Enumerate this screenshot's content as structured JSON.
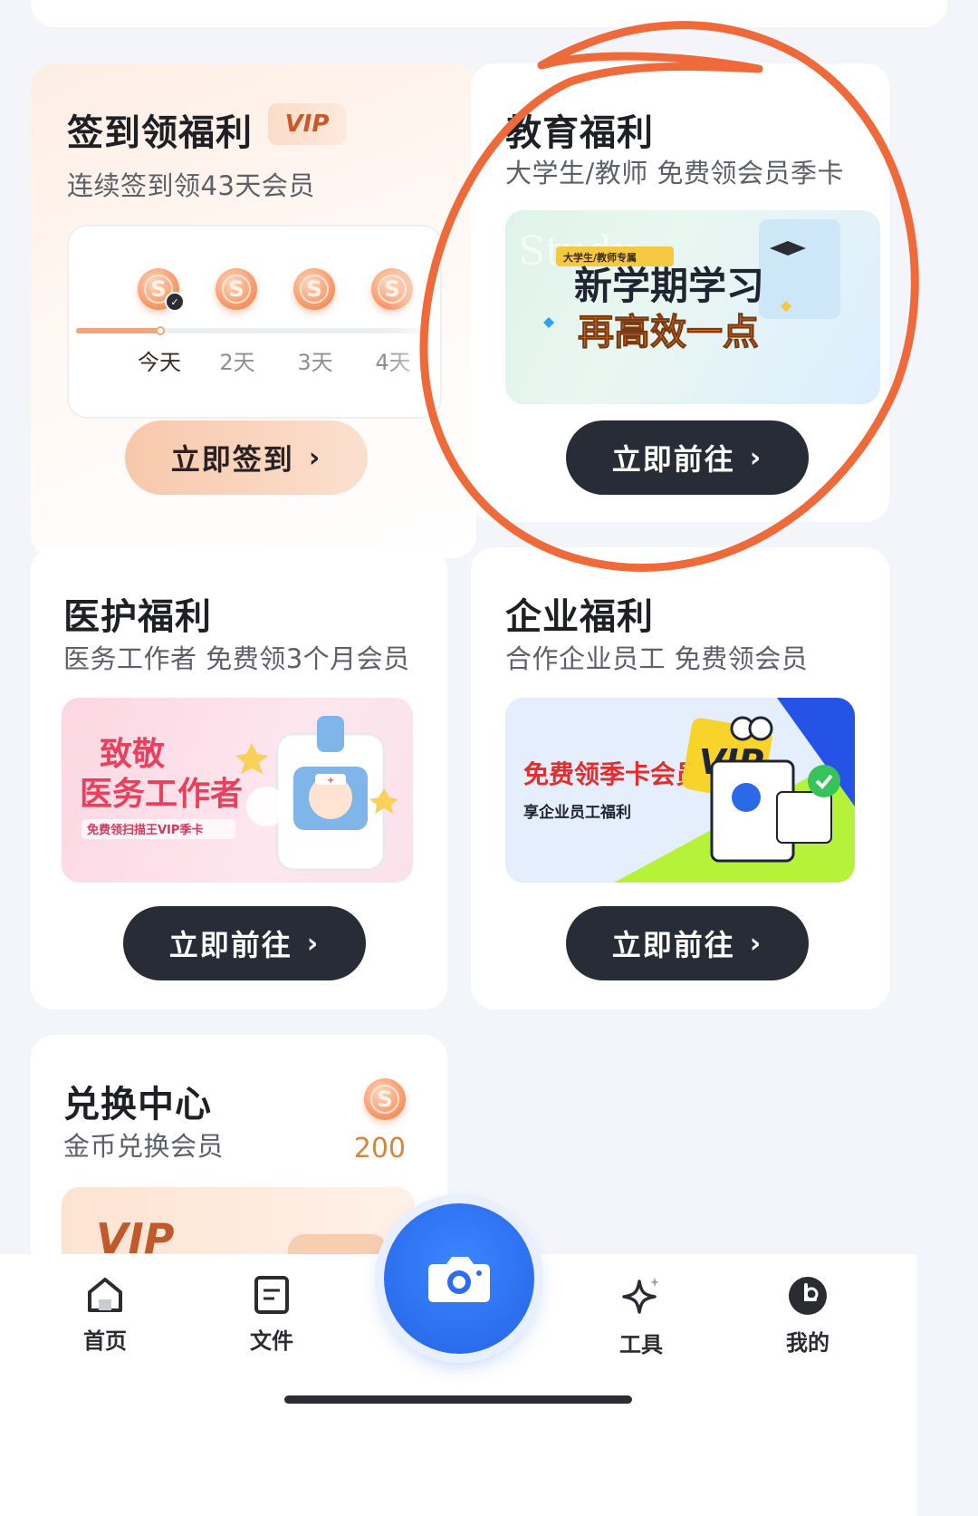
{
  "colors": {
    "accent": "#2563e6",
    "dark_button": "#272c36",
    "annotation": "#ef6a3a",
    "coin": "#f79b6b"
  },
  "checkin": {
    "title": "签到领福利",
    "vip_badge": "VIP",
    "subtitle": "连续签到领43天会员",
    "coin_glyph": "S",
    "days": [
      "今天",
      "2天",
      "3天",
      "4天"
    ],
    "button": "立即签到"
  },
  "education": {
    "title": "教育福利",
    "subtitle": "大学生/教师 免费领会员季卡",
    "banner": {
      "tag": "大学生/教师专属",
      "line1": "新学期学习",
      "line2": "再高效一点",
      "watermark": "Study"
    },
    "button": "立即前往"
  },
  "medical": {
    "title": "医护福利",
    "subtitle": "医务工作者 免费领3个月会员",
    "banner": {
      "line1": "致敬",
      "line2": "医务工作者",
      "caption": "免费领扫描王VIP季卡"
    },
    "button": "立即前往"
  },
  "enterprise": {
    "title": "企业福利",
    "subtitle": "合作企业员工 免费领会员",
    "banner": {
      "line1": "免费领季卡会员",
      "line2": "享企业员工福利",
      "badge": "VIP"
    },
    "button": "立即前往"
  },
  "exchange": {
    "title": "兑换中心",
    "subtitle": "金币兑换会员",
    "amount": "200",
    "banner_text": "VIP"
  },
  "button_chevron": "›",
  "nav": {
    "items": [
      {
        "label": "首页",
        "icon": "home-icon"
      },
      {
        "label": "文件",
        "icon": "file-icon"
      },
      {
        "label": "工具",
        "icon": "sparkle-icon"
      },
      {
        "label": "我的",
        "icon": "profile-icon"
      }
    ],
    "center": {
      "icon": "camera-icon"
    }
  }
}
